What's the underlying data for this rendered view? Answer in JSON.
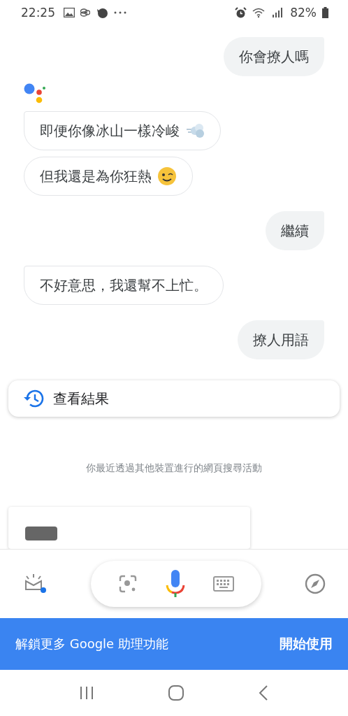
{
  "status_bar": {
    "time": "22:25",
    "battery": "82%"
  },
  "conversation": [
    {
      "kind": "user",
      "messages": [
        {
          "text": "你會撩人嗎"
        }
      ]
    },
    {
      "kind": "logo"
    },
    {
      "kind": "assistant",
      "messages": [
        {
          "kind": "dash_emoji",
          "text": "即便你像冰山一樣冷峻"
        },
        {
          "kind": "wink_emoji",
          "text": "但我還是為你狂熱"
        }
      ]
    },
    {
      "kind": "user",
      "messages": [
        {
          "text": "繼續"
        }
      ]
    },
    {
      "kind": "assistant",
      "messages": [
        {
          "text": "不好意思，我還幫不上忙。"
        }
      ]
    },
    {
      "kind": "user",
      "messages": [
        {
          "text": "撩人用語"
        }
      ]
    }
  ],
  "results_card": {
    "label": "查看結果"
  },
  "activity_note": "你最近透過其他裝置進行的網頁搜尋活動",
  "banner": {
    "text": "解鎖更多 Google 助理功能",
    "action": "開始使用"
  }
}
